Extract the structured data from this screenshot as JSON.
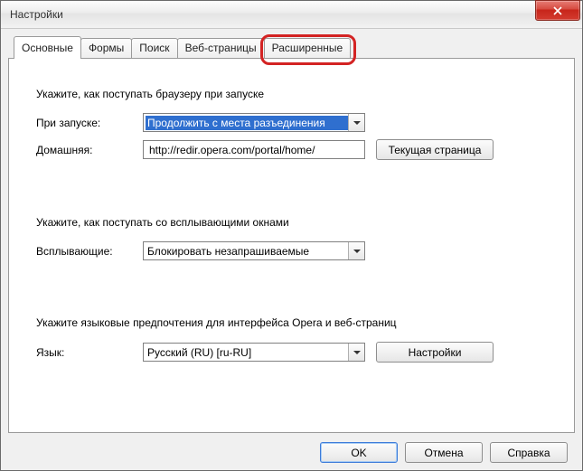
{
  "window": {
    "title": "Настройки"
  },
  "tabs": [
    {
      "label": "Основные"
    },
    {
      "label": "Формы"
    },
    {
      "label": "Поиск"
    },
    {
      "label": "Веб-страницы"
    },
    {
      "label": "Расширенные"
    }
  ],
  "startup": {
    "heading": "Укажите, как поступать браузеру при запуске",
    "on_startup_label": "При запуске:",
    "on_startup_value": "Продолжить с места разъединения",
    "homepage_label": "Домашняя:",
    "homepage_value": "http://redir.opera.com/portal/home/",
    "current_page_button": "Текущая страница"
  },
  "popups": {
    "heading": "Укажите, как поступать со всплывающими окнами",
    "label": "Всплывающие:",
    "value": "Блокировать незапрашиваемые"
  },
  "language": {
    "heading": "Укажите языковые предпочтения для интерфейса Opera и веб-страниц",
    "label": "Язык:",
    "value": "Русский (RU) [ru-RU]",
    "settings_button": "Настройки"
  },
  "buttons": {
    "ok": "OK",
    "cancel": "Отмена",
    "help": "Справка"
  }
}
